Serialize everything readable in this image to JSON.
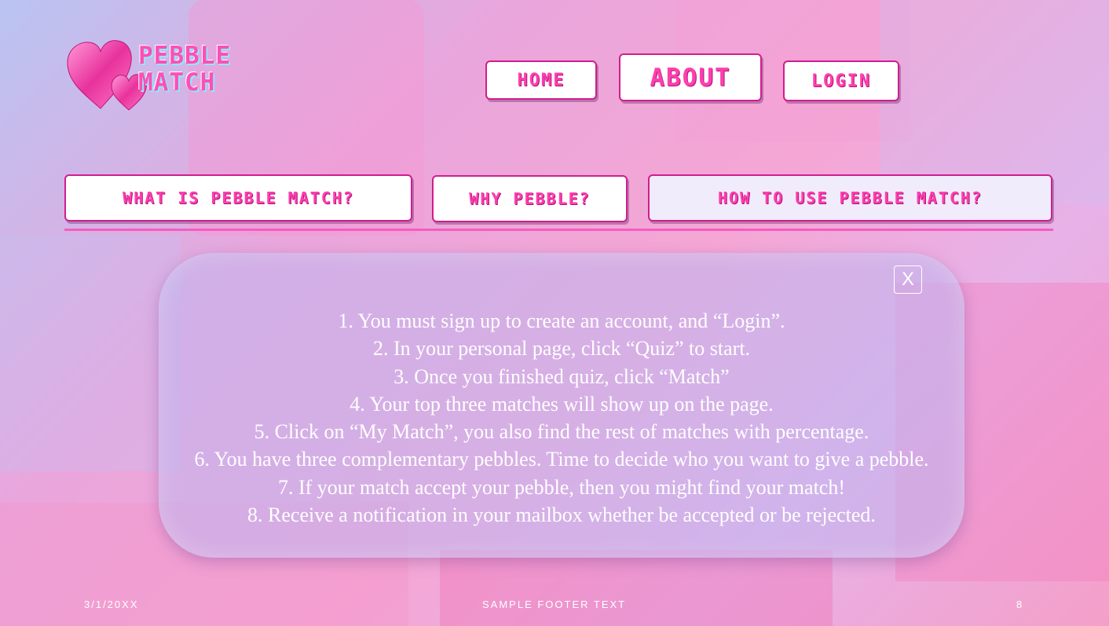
{
  "header": {
    "logo_text": "PEBBLE\nMATCH",
    "nav": [
      {
        "label": "Home"
      },
      {
        "label": "About"
      },
      {
        "label": "Login"
      }
    ]
  },
  "subnav": [
    {
      "label": "What is Pebble Match?"
    },
    {
      "label": "Why pebble?"
    },
    {
      "label": "How to use Pebble Match?"
    }
  ],
  "dialog": {
    "close_label": "X",
    "steps": [
      "1. You must sign up to create an account, and “Login”.",
      "2. In your personal page, click “Quiz” to start.",
      "3. Once you finished quiz, click “Match”",
      "4. Your top three matches will show up on the page.",
      "5.  Click on “My Match”, you also find the rest of matches with percentage.",
      "6. You have three complementary pebbles. Time to decide who you want to give a pebble.",
      "7. If your match accept your pebble, then you might find your match!",
      "8. Receive a notification in your mailbox whether be accepted or be rejected."
    ]
  },
  "footer": {
    "date": "3/1/20XX",
    "center": "SAMPLE FOOTER TEXT",
    "page": "8"
  },
  "colors": {
    "accent": "#ff3fae",
    "border": "#d01d8f",
    "rule": "#f45cc2"
  }
}
